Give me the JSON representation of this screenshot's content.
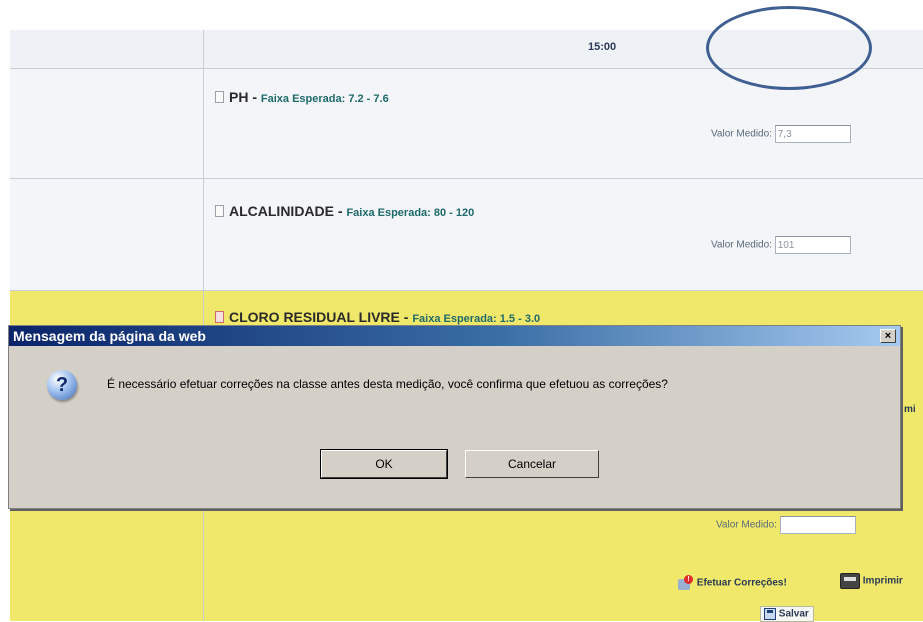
{
  "table": {
    "time_header": "15:00",
    "params": [
      {
        "name": "PH",
        "sep": " - ",
        "range": "Faixa Esperada: 7.2 - 7.6",
        "measure_label": "Valor Medido:",
        "measure_value": "7,3"
      },
      {
        "name": "ALCALINIDADE",
        "sep": " - ",
        "range": "Faixa Esperada: 80 - 120",
        "measure_label": "Valor Medido:",
        "measure_value": "101"
      },
      {
        "name": "CLORO RESIDUAL LIVRE",
        "sep": " - ",
        "range": "Faixa Esperada: 1.5 - 3.0",
        "measure_label": "Valor Medido:",
        "measure_value": ""
      }
    ],
    "partial_right_text": "mi",
    "actions": {
      "corrections": "Efetuar Correções!",
      "print": "Imprimir",
      "save": "Salvar"
    }
  },
  "dialog": {
    "title": "Mensagem da página da web",
    "close": "×",
    "icon_glyph": "?",
    "message": "É necessário efetuar correções na classe antes desta medição, você confirma que efetuou as correções?",
    "ok": "OK",
    "cancel": "Cancelar"
  },
  "colors": {
    "highlight_row": "#f0e86a",
    "annotation": "#3f5f92",
    "titlebar": "#0a246a"
  }
}
